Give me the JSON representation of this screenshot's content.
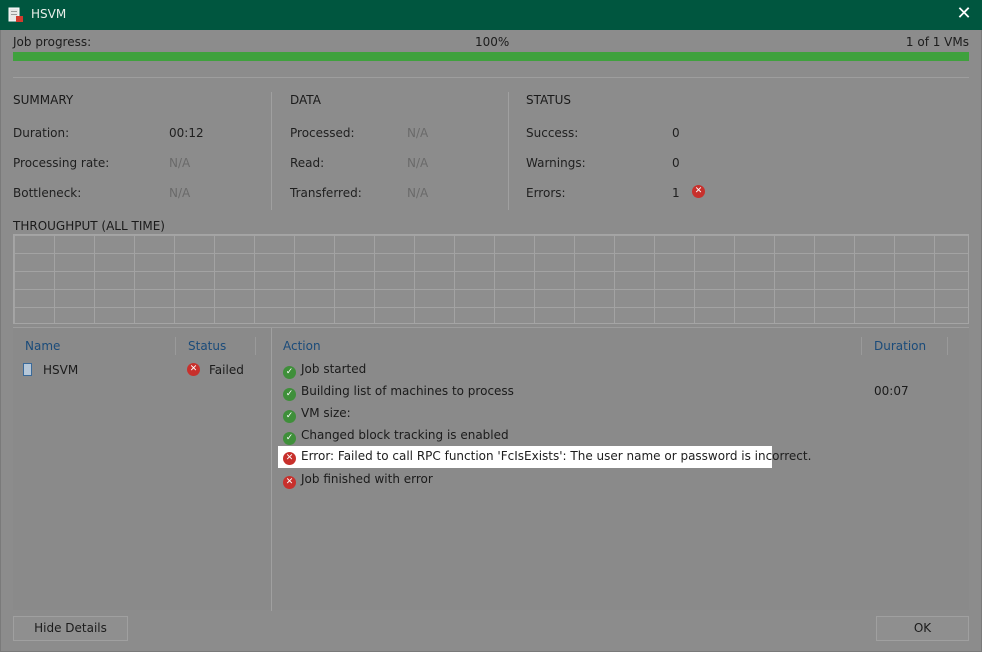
{
  "window": {
    "title": "HSVM",
    "app_icon": "veeam-job-icon",
    "close_glyph": "✕"
  },
  "progress": {
    "label": "Job progress:",
    "percent_text": "100%",
    "percent_value": 100,
    "count_text": "1 of 1 VMs",
    "bar_color": "#3fa13d"
  },
  "summary": {
    "title": "SUMMARY",
    "rows": [
      {
        "label": "Duration:",
        "value": "00:12"
      },
      {
        "label": "Processing rate:",
        "value": "N/A"
      },
      {
        "label": "Bottleneck:",
        "value": "N/A"
      }
    ]
  },
  "data_section": {
    "title": "DATA",
    "rows": [
      {
        "label": "Processed:",
        "value": "N/A"
      },
      {
        "label": "Read:",
        "value": "N/A"
      },
      {
        "label": "Transferred:",
        "value": "N/A"
      }
    ]
  },
  "status": {
    "title": "STATUS",
    "rows": [
      {
        "label": "Success:",
        "value": "0"
      },
      {
        "label": "Warnings:",
        "value": "0"
      },
      {
        "label": "Errors:",
        "value": "1"
      }
    ]
  },
  "throughput": {
    "title": "THROUGHPUT (ALL TIME)"
  },
  "vm_list": {
    "headers": {
      "name": "Name",
      "status": "Status"
    },
    "rows": [
      {
        "name": "HSVM",
        "status": "Failed",
        "status_icon": "error-icon"
      }
    ]
  },
  "actions": {
    "headers": {
      "action": "Action",
      "duration": "Duration"
    },
    "rows": [
      {
        "text": "Job started",
        "icon": "success-icon",
        "duration": ""
      },
      {
        "text": "Building list of machines to process",
        "icon": "success-icon",
        "duration": "00:07"
      },
      {
        "text": "VM size:",
        "icon": "success-icon",
        "duration": ""
      },
      {
        "text": "Changed block tracking is enabled",
        "icon": "success-icon",
        "duration": ""
      },
      {
        "text": "Error: Failed to call RPC function 'FcIsExists': The user name or password is incorrect.",
        "icon": "error-icon",
        "duration": ""
      },
      {
        "text": "Job finished with error",
        "icon": "error-icon",
        "duration": ""
      }
    ]
  },
  "buttons": {
    "hide_details": "Hide Details",
    "ok": "OK"
  },
  "colors": {
    "titlebar": "#00563f",
    "error": "#c8302c",
    "success": "#3f8f3a",
    "header_link": "#1a4b7a"
  }
}
